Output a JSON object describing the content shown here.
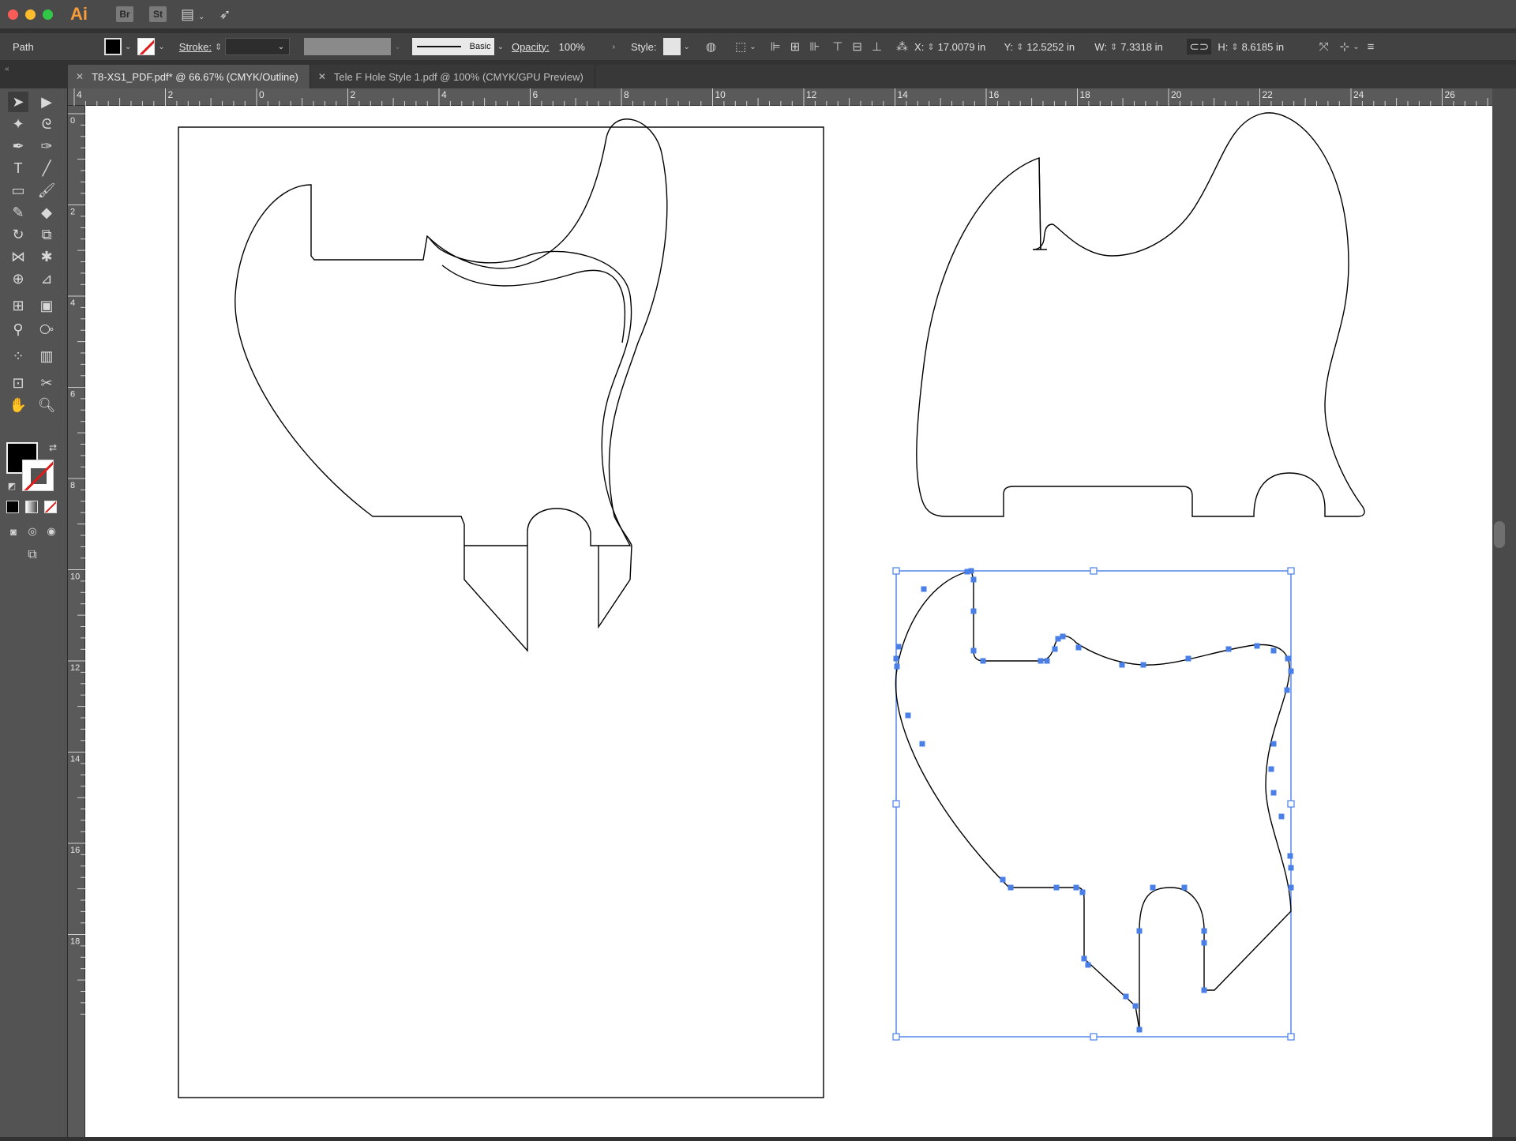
{
  "app": {
    "logo": "Ai",
    "bridge": "Br",
    "stock": "St"
  },
  "control": {
    "selection_type": "Path",
    "stroke_label": "Stroke:",
    "brush_label": "Basic",
    "opacity_label": "Opacity:",
    "opacity_value": "100%",
    "style_label": "Style:",
    "x_label": "X:",
    "x_value": "17.0079 in",
    "y_label": "Y:",
    "y_value": "12.5252 in",
    "w_label": "W:",
    "w_value": "7.3318 in",
    "h_label": "H:",
    "h_value": "8.6185 in"
  },
  "tabs": [
    {
      "label": "T8-XS1_PDF.pdf* @ 66.67% (CMYK/Outline)",
      "active": true
    },
    {
      "label": "Tele F Hole Style 1.pdf @ 100% (CMYK/GPU Preview)",
      "active": false
    }
  ],
  "ruler": {
    "top": [
      "4",
      "2",
      "0",
      "2",
      "4",
      "6",
      "8",
      "10",
      "12",
      "14",
      "16",
      "18",
      "20",
      "22",
      "24",
      "26"
    ],
    "left": [
      "0",
      "2",
      "4",
      "6",
      "8",
      "10",
      "12",
      "14",
      "16",
      "18"
    ]
  },
  "tools": {
    "icons": [
      "selection-tool-icon",
      "direct-selection-tool-icon",
      "magic-wand-tool-icon",
      "lasso-tool-icon",
      "pen-tool-icon",
      "curvature-tool-icon",
      "type-tool-icon",
      "line-tool-icon",
      "rectangle-tool-icon",
      "paintbrush-tool-icon",
      "pencil-tool-icon",
      "eraser-tool-icon",
      "rotate-tool-icon",
      "scale-tool-icon",
      "width-tool-icon",
      "puppet-warp-tool-icon",
      "shape-builder-tool-icon",
      "perspective-grid-tool-icon",
      "mesh-tool-icon",
      "gradient-tool-icon",
      "eyedropper-tool-icon",
      "blend-tool-icon",
      "symbol-sprayer-tool-icon",
      "column-graph-tool-icon",
      "artboard-tool-icon",
      "slice-tool-icon",
      "hand-tool-icon",
      "zoom-tool-icon"
    ]
  },
  "colors": {
    "selection": "#4a7fe8",
    "fill": "#000000",
    "stroke": "none"
  }
}
